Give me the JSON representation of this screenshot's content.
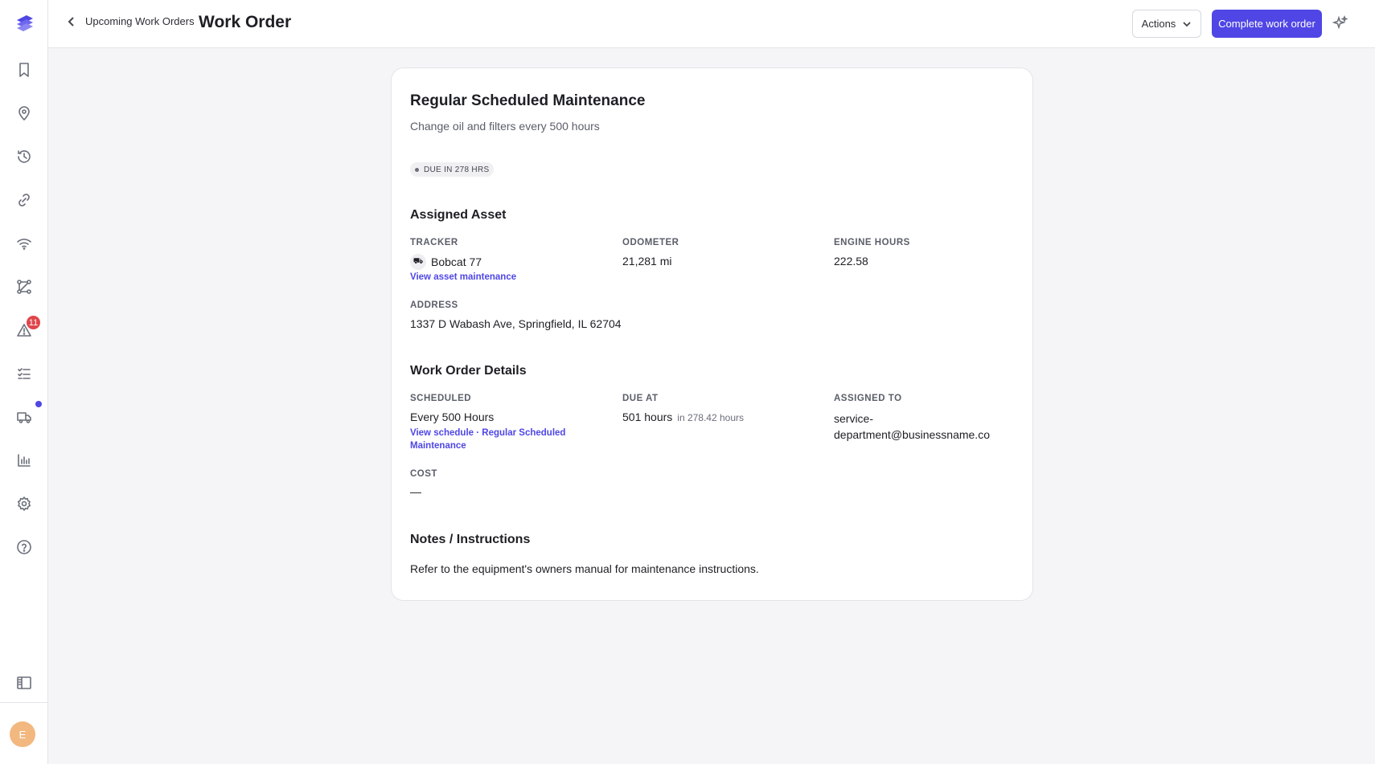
{
  "header": {
    "back_label": "Upcoming Work Orders",
    "title": "Work Order",
    "actions_label": "Actions",
    "complete_label": "Complete work order"
  },
  "sidebar": {
    "items": [
      {
        "name": "bookmark-icon"
      },
      {
        "name": "location-pin-icon"
      },
      {
        "name": "history-icon"
      },
      {
        "name": "link-icon"
      },
      {
        "name": "wifi-icon"
      },
      {
        "name": "route-icon"
      },
      {
        "name": "alert-icon",
        "badge": "11"
      },
      {
        "name": "checklist-icon"
      },
      {
        "name": "truck-icon"
      },
      {
        "name": "chart-icon"
      },
      {
        "name": "gear-icon"
      },
      {
        "name": "help-icon"
      }
    ],
    "collapse_icon": "sidebar-toggle-icon",
    "avatar_initial": "E",
    "colors": {
      "badge": "#e0454a",
      "accent": "#4f46e5",
      "avatar": "#f2b880"
    }
  },
  "work_order": {
    "title": "Regular Scheduled Maintenance",
    "subtitle": "Change oil and filters every 500 hours",
    "status": "DUE IN 278 HRS",
    "assigned_asset": {
      "heading": "Assigned Asset",
      "tracker_label": "TRACKER",
      "tracker_value": "Bobcat 77",
      "tracker_link": "View asset maintenance",
      "odometer_label": "ODOMETER",
      "odometer_value": "21,281 mi",
      "engine_hours_label": "ENGINE HOURS",
      "engine_hours_value": "222.58",
      "address_label": "ADDRESS",
      "address_value": "1337 D Wabash Ave, Springfield, IL 62704"
    },
    "details": {
      "heading": "Work Order Details",
      "scheduled_label": "SCHEDULED",
      "scheduled_value": "Every 500 Hours",
      "schedule_link_line1": "View schedule · Regular Scheduled",
      "schedule_link_line2": "Maintenance",
      "due_label": "DUE AT",
      "due_value": "501 hours",
      "due_note": "in 278.42 hours",
      "assigned_label": "ASSIGNED TO",
      "assigned_line1": "service-",
      "assigned_line2": "department@businessname.co",
      "cost_label": "COST",
      "cost_value": "—"
    },
    "notes": {
      "heading": "Notes / Instructions",
      "text": "Refer to the equipment's owners manual for maintenance instructions."
    }
  }
}
